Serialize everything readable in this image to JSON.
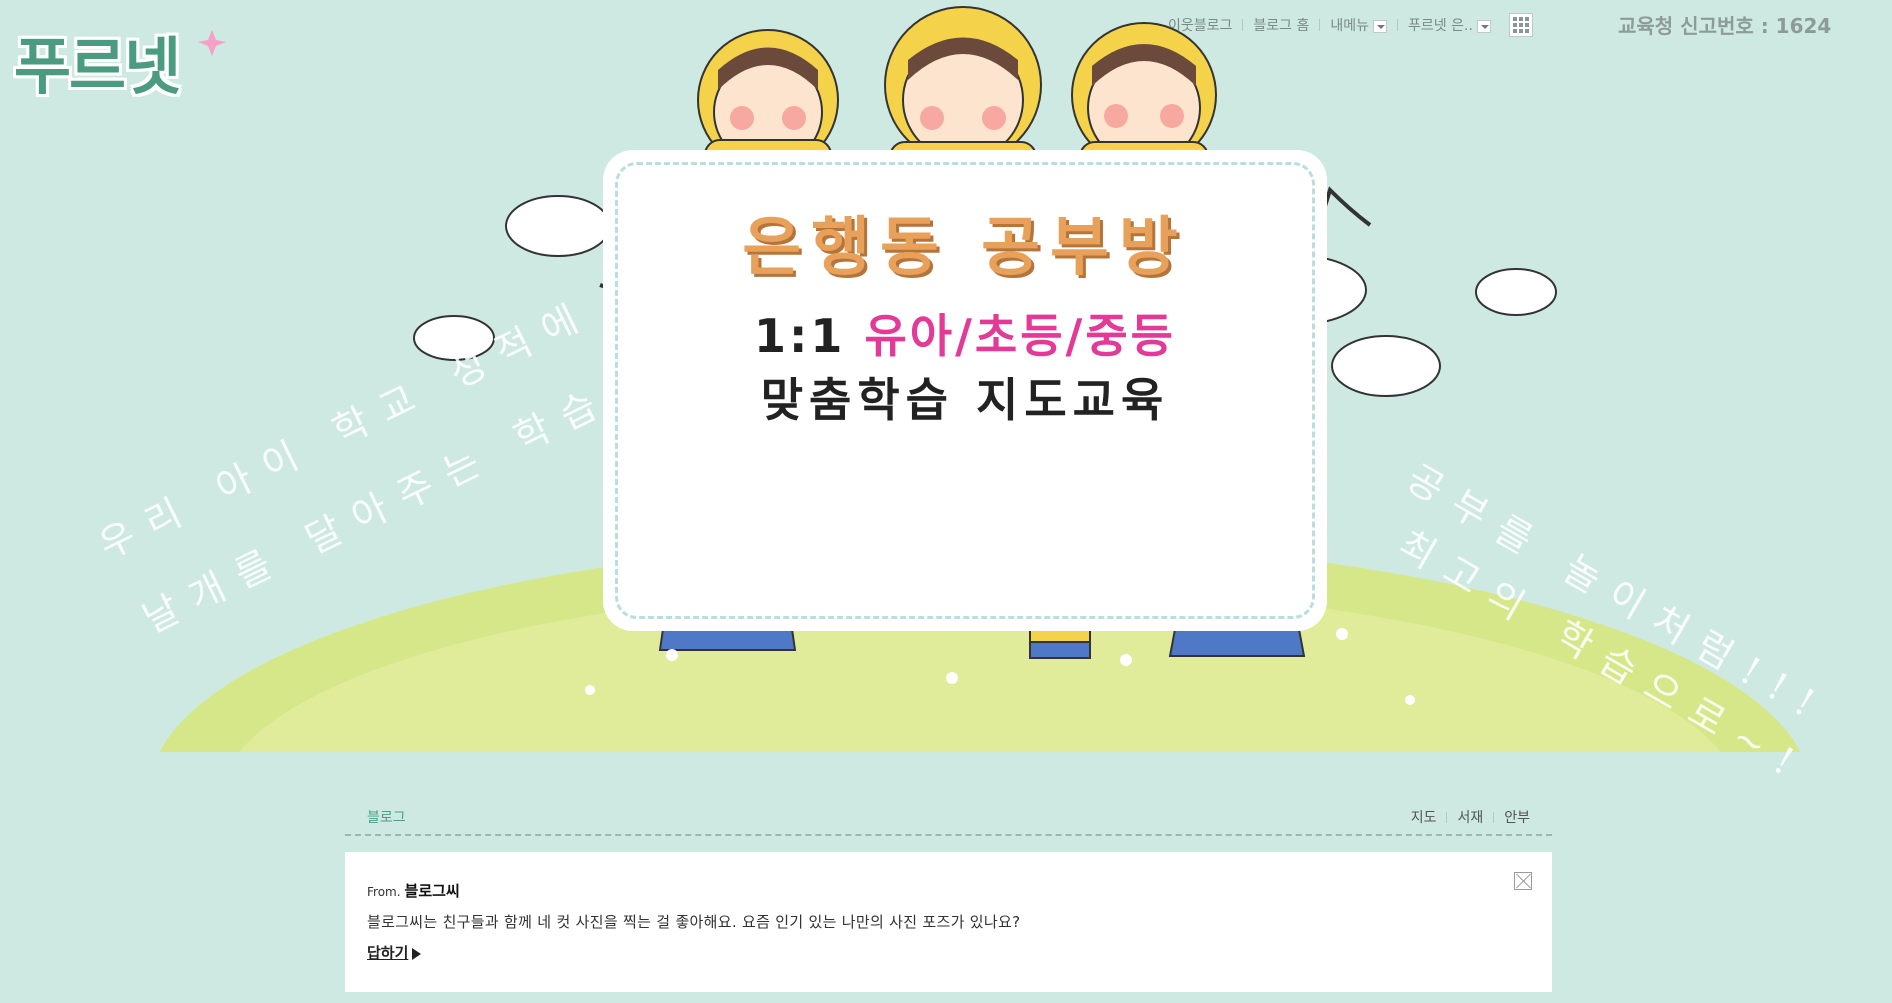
{
  "logo": {
    "text": "푸르넷"
  },
  "topnav": {
    "items": [
      "이웃블로그",
      "블로그 홈",
      "내메뉴",
      "푸르넷 은.."
    ],
    "report_no": "교육청 신고번호 : 1624"
  },
  "banner": {
    "title": "은행동 공부방",
    "line1_prefix": "1:1 ",
    "line1_highlight": "유아/초등/중등",
    "line2": "맞춤학습 지도교육",
    "slogan_left_1": "우리 아이 학교 성적에",
    "slogan_left_2": "날개를 달아주는 학습",
    "slogan_right_1": "공부를 놀이처럼!!!",
    "slogan_right_2": "최고의 학습으로~!"
  },
  "tabs": {
    "left": "블로그",
    "right": [
      "지도",
      "서재",
      "안부"
    ]
  },
  "message": {
    "from_label": "From.",
    "from_name": "블로그씨",
    "text": "블로그씨는 친구들과 함께 네 컷 사진을 찍는 걸 좋아해요. 요즘 인기 있는 나만의 사진 포즈가 있나요?",
    "reply": "답하기"
  },
  "colors": {
    "background": "#cde9e1",
    "accent": "#4a9b80",
    "hill": "#d9e88f",
    "pink": "#e23a96"
  }
}
